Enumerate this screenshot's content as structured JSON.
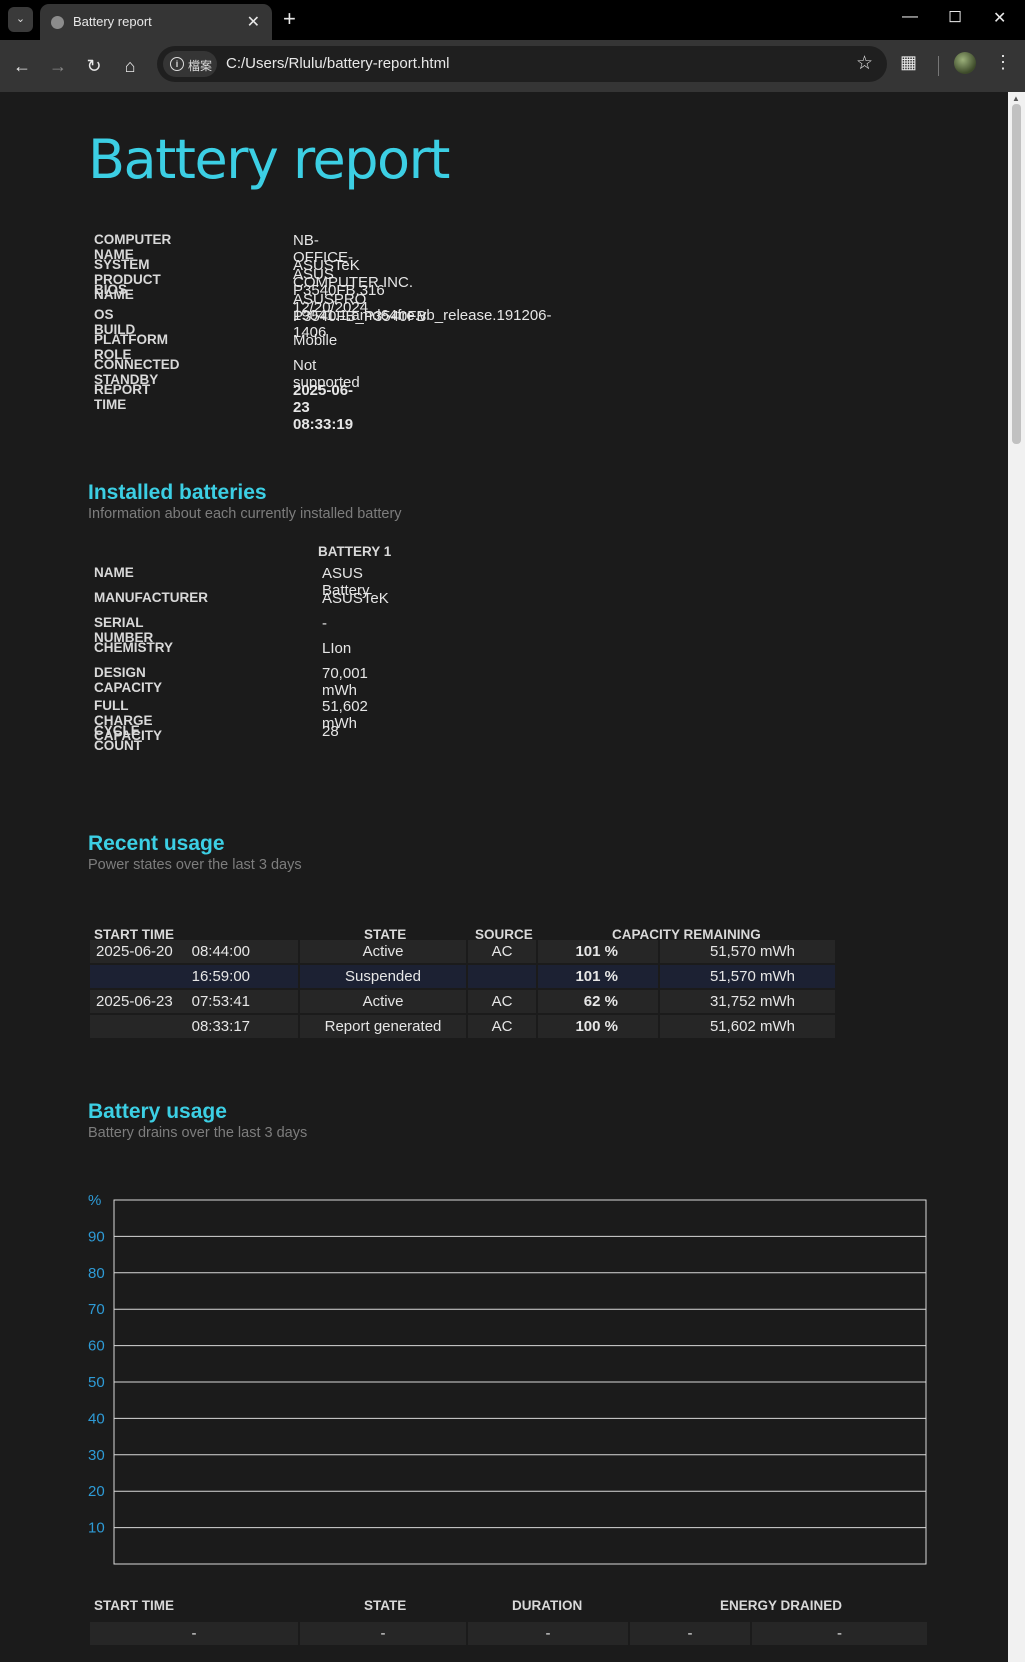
{
  "browser": {
    "tab_title": "Battery report",
    "site_label": "檔案",
    "url": "C:/Users/Rlulu/battery-report.html"
  },
  "report": {
    "title": "Battery report",
    "system_info": [
      {
        "label": "COMPUTER NAME",
        "value": "NB-OFFICE-ASUS"
      },
      {
        "label": "SYSTEM PRODUCT NAME",
        "value": "ASUSTeK COMPUTER INC. ASUSPRO P3540FB_P3540FB"
      },
      {
        "label": "BIOS",
        "value": "P3540FB.316 12/20/2024"
      },
      {
        "label": "OS BUILD",
        "value": "19041.1.amd64fre.vb_release.191206-1406"
      },
      {
        "label": "PLATFORM ROLE",
        "value": "Mobile"
      },
      {
        "label": "CONNECTED STANDBY",
        "value": "Not supported"
      },
      {
        "label": "REPORT TIME",
        "value": "2025-06-23  08:33:19"
      }
    ]
  },
  "installed_batteries": {
    "heading": "Installed batteries",
    "subtitle": "Information about each currently installed battery",
    "column": "BATTERY 1",
    "rows": [
      {
        "label": "NAME",
        "value": "ASUS Battery"
      },
      {
        "label": "MANUFACTURER",
        "value": "ASUSTeK"
      },
      {
        "label": "SERIAL NUMBER",
        "value": "-"
      },
      {
        "label": "CHEMISTRY",
        "value": "LIon"
      },
      {
        "label": "DESIGN CAPACITY",
        "value": "70,001 mWh"
      },
      {
        "label": "FULL CHARGE CAPACITY",
        "value": "51,602 mWh"
      },
      {
        "label": "CYCLE COUNT",
        "value": "28"
      }
    ]
  },
  "recent_usage": {
    "heading": "Recent usage",
    "subtitle": "Power states over the last 3 days",
    "headers": {
      "start_time": "START TIME",
      "state": "STATE",
      "source": "SOURCE",
      "capacity": "CAPACITY REMAINING"
    },
    "rows": [
      {
        "date": "2025-06-20",
        "time": "08:44:00",
        "state": "Active",
        "source": "AC",
        "percent": "101 %",
        "mwh": "51,570 mWh"
      },
      {
        "date": "",
        "time": "16:59:00",
        "state": "Suspended",
        "source": "",
        "percent": "101 %",
        "mwh": "51,570 mWh"
      },
      {
        "date": "2025-06-23",
        "time": "07:53:41",
        "state": "Active",
        "source": "AC",
        "percent": "62 %",
        "mwh": "31,752 mWh"
      },
      {
        "date": "",
        "time": "08:33:17",
        "state": "Report generated",
        "source": "AC",
        "percent": "100 %",
        "mwh": "51,602 mWh"
      }
    ]
  },
  "battery_usage": {
    "heading": "Battery usage",
    "subtitle": "Battery drains over the last 3 days",
    "headers": {
      "start_time": "START TIME",
      "state": "STATE",
      "duration": "DURATION",
      "energy_drained": "ENERGY DRAINED"
    },
    "row": [
      "-",
      "-",
      "-",
      "-",
      "-"
    ]
  },
  "chart_data": {
    "type": "line",
    "title": "",
    "xlabel": "",
    "ylabel": "%",
    "ylim": [
      0,
      100
    ],
    "y_ticks": [
      "%",
      "90",
      "80",
      "70",
      "60",
      "50",
      "40",
      "30",
      "20",
      "10"
    ],
    "grid": true,
    "series": []
  },
  "colors": {
    "accent": "#3ccfe4",
    "axis_tick": "#2e9bd6",
    "background": "#1b1b1b",
    "row_alt": "#1c2133"
  }
}
